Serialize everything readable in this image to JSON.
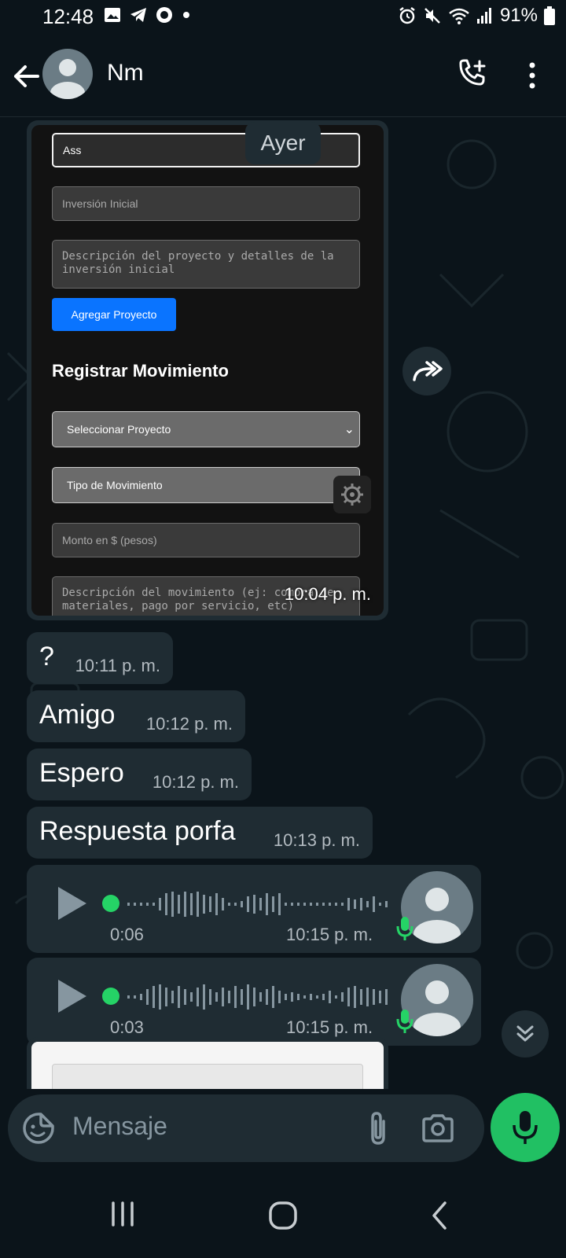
{
  "status": {
    "time": "12:48",
    "battery": "91%",
    "left_icons": [
      "gallery-icon",
      "telegram-icon",
      "vpn-icon",
      "dot-icon"
    ],
    "right_icons": [
      "alarm-icon",
      "mute-icon",
      "wifi-icon",
      "signal-icon",
      "battery-icon"
    ]
  },
  "header": {
    "contact_name": "Nm"
  },
  "chat": {
    "date_chip": "Ayer",
    "image_message": {
      "time": "10:04 p. m.",
      "form": {
        "field_name": "Ass",
        "field_investment": "Inversión Inicial",
        "field_description": "Descripción del proyecto y detalles de la inversión inicial",
        "button_add": "Agregar Proyecto",
        "section_title": "Registrar Movimiento",
        "select_project": "Seleccionar Proyecto",
        "select_type": "Tipo de Movimiento",
        "field_amount": "Monto en $ (pesos)",
        "field_movement_desc": "Descripción del movimiento (ej: compra de materiales, pago por servicio, etc)"
      }
    },
    "messages": [
      {
        "text": "?",
        "time": "10:11 p. m."
      },
      {
        "text": "Amigo",
        "time": "10:12 p. m."
      },
      {
        "text": "Espero",
        "time": "10:12 p. m."
      },
      {
        "text": "Respuesta porfa",
        "time": "10:13 p. m."
      }
    ],
    "voice_notes": [
      {
        "duration": "0:06",
        "time": "10:15 p. m."
      },
      {
        "duration": "0:03",
        "time": "10:15 p. m."
      }
    ]
  },
  "input": {
    "placeholder": "Mensaje"
  },
  "colors": {
    "accent": "#21c063",
    "bubble": "#1f2c33",
    "background": "#0b141a"
  }
}
